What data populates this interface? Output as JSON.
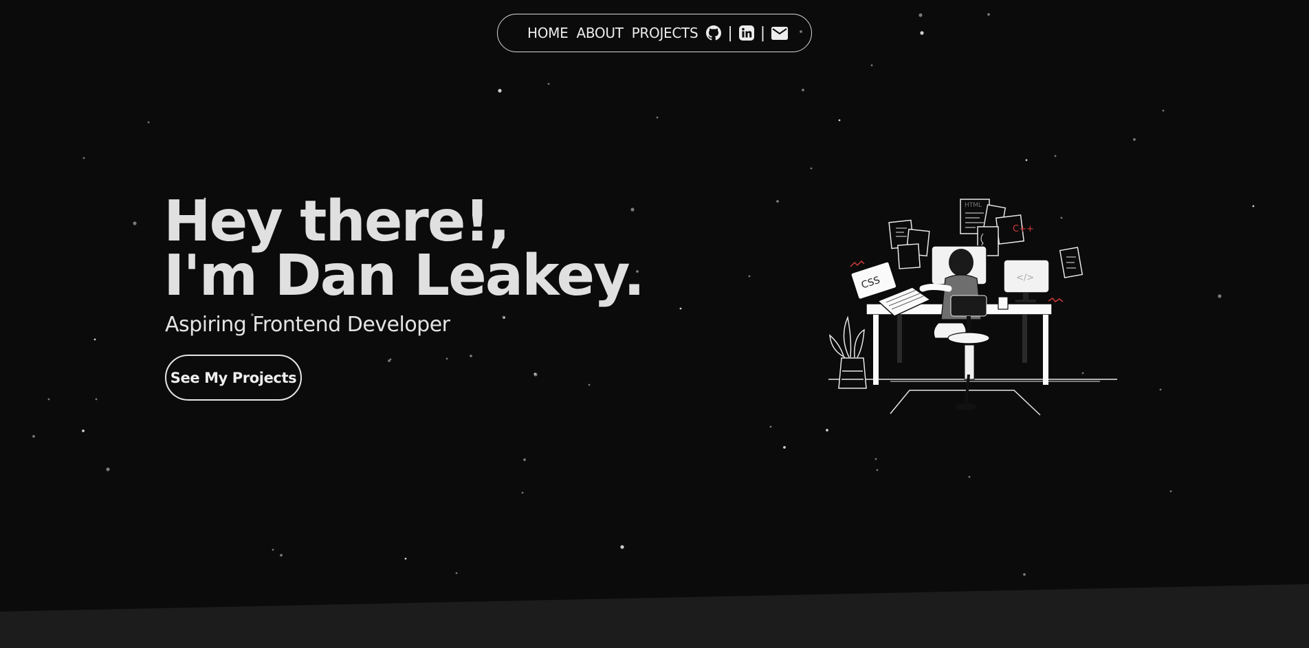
{
  "nav": {
    "links": [
      "HOME",
      "ABOUT",
      "PROJECTS"
    ],
    "separator": "|",
    "icons": [
      "github-icon",
      "linkedin-icon",
      "mail-icon"
    ]
  },
  "hero": {
    "line1": "Hey there!,",
    "line2": "I'm Dan Leakey.",
    "subtitle": "Aspiring Frontend Developer",
    "cta_label": "See My Projects"
  },
  "illustration": {
    "icon": "developer-at-desk-illustration",
    "labels": {
      "laptop": "CSS",
      "note_html": "HTML",
      "note_cpp": "C++",
      "monitor": "</>"
    }
  },
  "colors": {
    "background": "#0b0b0b",
    "bottom_band": "#1c1c1c",
    "text": "#e0e0e0",
    "accent_red": "#d23b3b"
  }
}
